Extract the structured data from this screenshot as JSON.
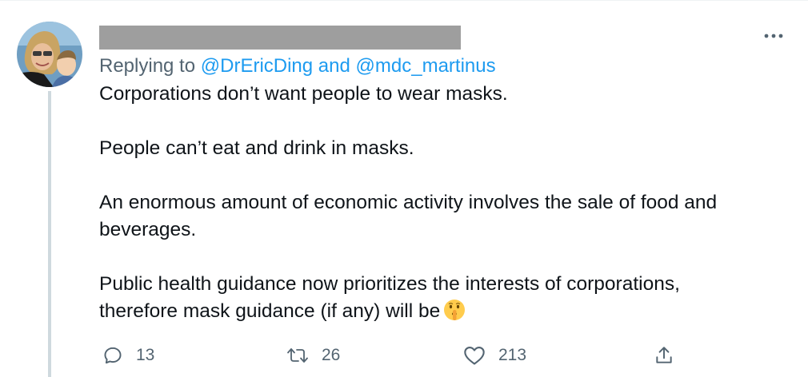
{
  "tweet": {
    "reply_prefix": "Replying to ",
    "reply_handle_1": "@DrEricDing",
    "reply_and": " and ",
    "reply_handle_2": "@mdc_martinus",
    "paragraphs": [
      "Corporations don’t want people to wear masks.",
      "People can’t eat and drink in masks.",
      "An enormous amount of economic activity involves the sale of food and",
      "beverages.",
      "Public health guidance now prioritizes the interests of corporations,",
      "therefore mask guidance (if any) will be"
    ],
    "emoji_icon": "shushing-face-emoji"
  },
  "actions": {
    "reply_count": "13",
    "retweet_count": "26",
    "like_count": "213",
    "share_icon": "share-icon"
  },
  "colors": {
    "link": "#1d9bf0",
    "secondary_text": "#536471",
    "thread_line": "#cfd9de",
    "redaction": "#9e9e9e"
  }
}
